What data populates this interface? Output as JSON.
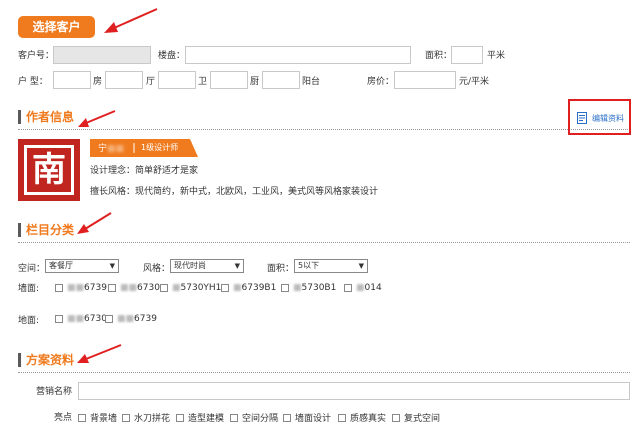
{
  "customer": {
    "select_button": "选择客户",
    "id_label": "客户号：",
    "estate_label": "楼盘：",
    "area_label": "面积：",
    "area_unit": "平米",
    "layout_label": "户  型：",
    "room_unit": "房",
    "hall_unit": "厅",
    "bath_unit": "卫",
    "kitchen_unit": "厨",
    "balcony_unit": "阳台",
    "price_label": "房价：",
    "price_unit": "元/平米"
  },
  "author": {
    "section_title": "作者信息",
    "edit_link": "编辑资料",
    "name": "宁",
    "level": "1级设计师",
    "concept": "设计理念：简单舒适才是家",
    "styles": "擅长风格：现代简约，新中式，北欧风，工业风，美式风等风格家装设计",
    "logo_char": "南"
  },
  "category": {
    "section_title": "栏目分类",
    "space_label": "空间：",
    "space_value": "客餐厅",
    "style_label": "风格：",
    "style_value": "现代时尚",
    "area_label": "面积：",
    "area_value": "5以下",
    "wall_label": "墙面:",
    "wall_items": [
      "6739",
      "6730",
      "5730YH1",
      "6739B1",
      "5730B1",
      "014"
    ],
    "floor_label": "地面:",
    "floor_items": [
      "6730",
      "6739"
    ]
  },
  "plan": {
    "section_title": "方案资料",
    "marketing_label": "营销名称",
    "highlights_label": "亮点",
    "highlights": [
      "背景墙",
      "水刀拼花",
      "造型建模",
      "空间分隔",
      "墙面设计",
      "质感真实",
      "复式空间"
    ]
  },
  "colors": {
    "accent": "#f07a1e",
    "arrow": "#e02020",
    "logo_red": "#c0251f"
  }
}
